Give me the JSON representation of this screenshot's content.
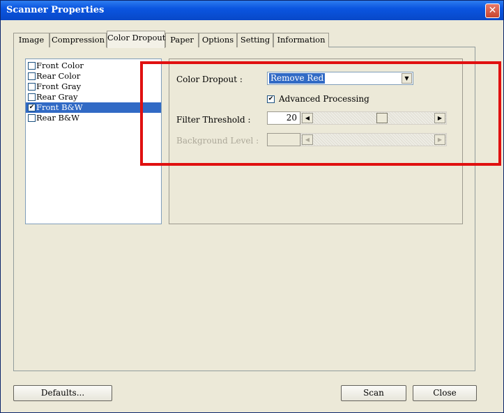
{
  "window": {
    "title": "Scanner Properties",
    "close_glyph": "✕"
  },
  "tabs": [
    {
      "label": "Image"
    },
    {
      "label": "Compression"
    },
    {
      "label": "Color Dropout",
      "active": true
    },
    {
      "label": "Paper"
    },
    {
      "label": "Options"
    },
    {
      "label": "Setting"
    },
    {
      "label": "Information"
    }
  ],
  "image_list": [
    {
      "label": "Front Color",
      "checked": false
    },
    {
      "label": "Rear Color",
      "checked": false
    },
    {
      "label": "Front Gray",
      "checked": false
    },
    {
      "label": "Rear Gray",
      "checked": false
    },
    {
      "label": "Front B&W",
      "checked": true,
      "selected": true
    },
    {
      "label": "Rear B&W",
      "checked": false
    }
  ],
  "color_dropout": {
    "label": "Color Dropout :",
    "selected": "Remove Red",
    "advanced_label": "Advanced Processing",
    "advanced_checked": true
  },
  "filter_threshold": {
    "label": "Filter Threshold :",
    "value": "20",
    "slider_fraction": 0.58
  },
  "background_level": {
    "label": "Background Level :",
    "value": "",
    "enabled": false
  },
  "glyphs": {
    "check": "✔",
    "arrow_left": "◀",
    "arrow_right": "▶",
    "arrow_down": "▼"
  },
  "buttons": {
    "defaults": "Defaults...",
    "scan": "Scan",
    "close": "Close"
  },
  "colors": {
    "titlebar": "#0a55e0",
    "selection": "#316ac5",
    "highlight_box": "#e01010",
    "dialog_bg": "#ece9d8"
  }
}
